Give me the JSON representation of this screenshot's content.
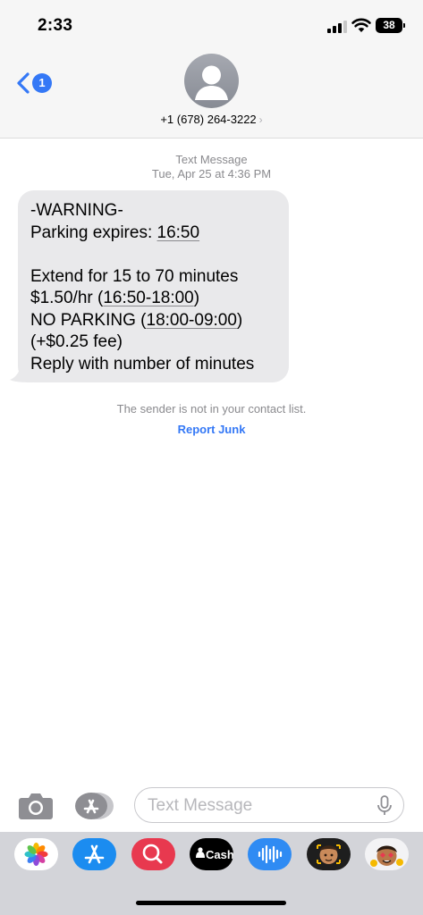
{
  "status_bar": {
    "time": "2:33",
    "battery": "38"
  },
  "header": {
    "back_badge": "1",
    "contact": "+1 (678) 264-3222",
    "contact_chevron": "›"
  },
  "conversation": {
    "service": "Text Message",
    "timestamp": "Tue, Apr 25 at 4:36 PM",
    "message": {
      "line1": "-WARNING-",
      "line2_prefix": "Parking expires: ",
      "line2_time": "16:50",
      "line4": "Extend for 15 to 70 minutes",
      "line5_prefix": "$1.50/hr (",
      "line5_range": "16:50-18:00",
      "line5_suffix": ")",
      "line6_prefix": "NO PARKING (",
      "line6_range": "18:00-09:00",
      "line6_suffix": ")",
      "line7": "(+$0.25 fee)",
      "line8": "Reply with number of minutes"
    },
    "notice": "The sender is not in your contact list.",
    "report_junk": "Report Junk"
  },
  "input_bar": {
    "placeholder": "Text Message"
  },
  "app_drawer": {
    "apps": [
      {
        "name": "photos-icon",
        "color": "#ffffff"
      },
      {
        "name": "app-store-icon",
        "color": "#1b8cf0"
      },
      {
        "name": "images-search-icon",
        "color": "#e8394f"
      },
      {
        "name": "apple-cash-icon",
        "color": "#000000",
        "label": "Cash"
      },
      {
        "name": "audio-message-icon",
        "color": "#2f8bf3"
      },
      {
        "name": "memoji-icon",
        "color": "#1e1e1e"
      },
      {
        "name": "memoji-stickers-icon",
        "color": "#f3f3f5"
      }
    ]
  },
  "colors": {
    "accent": "#3478f6",
    "bubble": "#e9e9eb",
    "secondary_text": "#8a8a8e"
  }
}
